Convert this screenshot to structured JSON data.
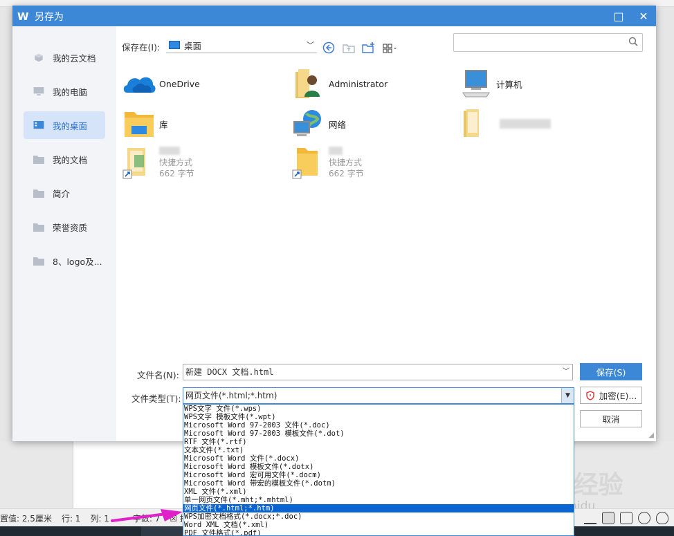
{
  "dialog": {
    "title": "另存为",
    "logo": "W",
    "buttons": {
      "maximize": "□",
      "close": "✕"
    }
  },
  "sidebar": {
    "items": [
      {
        "label": "我的云文档",
        "icon": "cube-icon",
        "active": false
      },
      {
        "label": "我的电脑",
        "icon": "monitor-icon",
        "active": false
      },
      {
        "label": "我的桌面",
        "icon": "desktop-icon",
        "active": true
      },
      {
        "label": "我的文档",
        "icon": "folder-icon",
        "active": false
      },
      {
        "label": "简介",
        "icon": "folder-icon",
        "active": false
      },
      {
        "label": "荣誉资质",
        "icon": "folder-icon",
        "active": false
      },
      {
        "label": "8、logo及...",
        "icon": "folder-icon",
        "active": false
      }
    ]
  },
  "location": {
    "label": "保存在(I):",
    "value": "桌面"
  },
  "search": {
    "placeholder": ""
  },
  "files": [
    {
      "name": "OneDrive",
      "icon": "onedrive-cloud-icon"
    },
    {
      "name": "Administrator",
      "icon": "user-folder-icon"
    },
    {
      "name": "计算机",
      "icon": "computer-icon"
    },
    {
      "name": "库",
      "icon": "library-folder-icon"
    },
    {
      "name": "网络",
      "icon": "network-icon"
    },
    {
      "name": "",
      "icon": "folder-icon"
    },
    {
      "name": "",
      "icon": "shortcut-folder-icon",
      "type": "快捷方式",
      "size": "662 字节"
    },
    {
      "name": "",
      "icon": "shortcut-folder-icon",
      "type": "快捷方式",
      "size": "662 字节"
    }
  ],
  "form": {
    "filename_label": "文件名(N):",
    "filename_value": "新建 DOCX 文档.html",
    "filetype_label": "文件类型(T):",
    "filetype_value": "网页文件(*.html;*.htm)",
    "save_button": "保存(S)",
    "encrypt_button": "加密(E)...",
    "cancel_button": "取消"
  },
  "filetype_options": [
    "WPS文字 文件(*.wps)",
    "WPS文字 模板文件(*.wpt)",
    "Microsoft Word 97-2003 文件(*.doc)",
    "Microsoft Word 97-2003 模板文件(*.dot)",
    "RTF 文件(*.rtf)",
    "文本文件(*.txt)",
    "Microsoft Word 文件(*.docx)",
    "Microsoft Word 模板文件(*.dotx)",
    "Microsoft Word 宏可用文件(*.docm)",
    "Microsoft Word 带宏的模板文件(*.dotm)",
    "XML 文件(*.xml)",
    "单一网页文件(*.mht;*.mhtml)",
    "网页文件(*.html;*.htm)",
    "WPS加密文档格式(*.docx;*.doc)",
    "Word XML 文档(*.xml)",
    "PDF 文件格式(*.pdf)"
  ],
  "selected_option_index": 12,
  "statusbar": {
    "setting": "置值: 2.5厘米",
    "row": "行: 1",
    "col": "列: 1",
    "wordcount": "字数: 7",
    "spell": "拼"
  },
  "watermark": {
    "main": "Bai 经验",
    "sub": "jingyan.baidu"
  },
  "colors": {
    "titlebar": "#3c87d6",
    "selected": "#0a64d2",
    "arrow": "#e020c8"
  }
}
